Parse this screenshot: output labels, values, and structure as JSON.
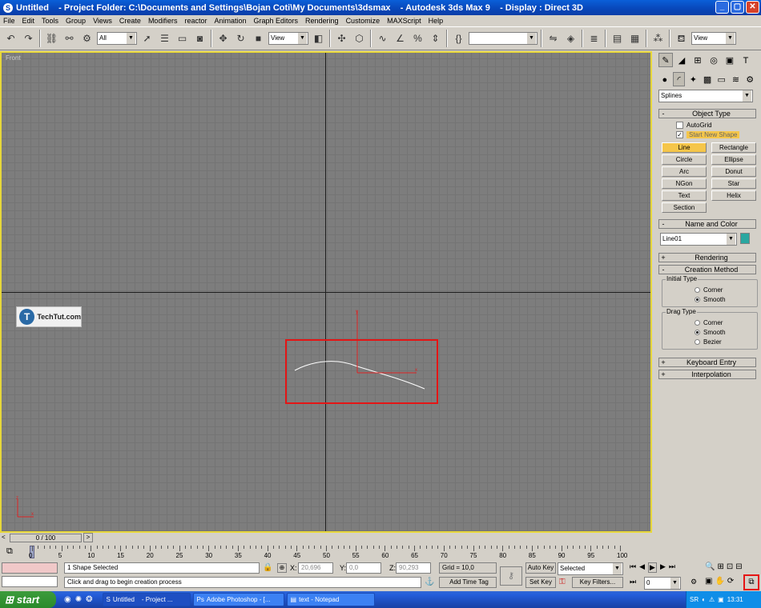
{
  "window": {
    "title": "Untitled    - Project Folder: C:\\Documents and Settings\\Bojan Coti\\My Documents\\3dsmax    - Autodesk 3ds Max 9    - Display : Direct 3D",
    "controls": [
      "_",
      "▢",
      "✕"
    ]
  },
  "menu": [
    "File",
    "Edit",
    "Tools",
    "Group",
    "Views",
    "Create",
    "Modifiers",
    "reactor",
    "Animation",
    "Graph Editors",
    "Rendering",
    "Customize",
    "MAXScript",
    "Help"
  ],
  "toolbar": {
    "selection_filter": "All",
    "ref_coord": "View",
    "named_selection": "",
    "view_right": "View"
  },
  "viewport": {
    "label": "Front",
    "watermark": "TechTut.com",
    "watermark_logo": "T"
  },
  "command_panel": {
    "category": "Splines",
    "object_type": {
      "header": "Object Type",
      "sign": "-",
      "autogrid": "AutoGrid",
      "start_new_shape": "Start New Shape",
      "buttons": [
        "Line",
        "Rectangle",
        "Circle",
        "Ellipse",
        "Arc",
        "Donut",
        "NGon",
        "Star",
        "Text",
        "Helix",
        "Section"
      ],
      "active": "Line"
    },
    "name_color": {
      "header": "Name and Color",
      "sign": "-",
      "name": "Line01",
      "color": "#2aa7a0"
    },
    "rendering": {
      "header": "Rendering",
      "sign": "+"
    },
    "creation_method": {
      "header": "Creation Method",
      "sign": "-",
      "initial_type": {
        "label": "Initial Type",
        "options": [
          "Corner",
          "Smooth"
        ],
        "selected": "Smooth"
      },
      "drag_type": {
        "label": "Drag Type",
        "options": [
          "Corner",
          "Smooth",
          "Bezier"
        ],
        "selected": "Smooth"
      }
    },
    "keyboard_entry": {
      "header": "Keyboard Entry",
      "sign": "+"
    },
    "interpolation": {
      "header": "Interpolation",
      "sign": "+"
    }
  },
  "timeline": {
    "slider": "0 / 100",
    "ticks": [
      "0",
      "5",
      "10",
      "15",
      "20",
      "25",
      "30",
      "35",
      "40",
      "45",
      "50",
      "55",
      "60",
      "65",
      "70",
      "75",
      "80",
      "85",
      "90",
      "95",
      "100"
    ]
  },
  "status": {
    "selection": "1 Shape Selected",
    "prompt": "Click and drag to begin creation process",
    "x_label": "X:",
    "x": "20,696",
    "y_label": "Y:",
    "y": "0,0",
    "z_label": "Z:",
    "z": "90,293",
    "grid": "Grid = 10,0",
    "add_time_tag": "Add Time Tag",
    "auto_key": "Auto Key",
    "set_key": "Set Key",
    "key_mode": "Selected",
    "key_filters": "Key Filters...",
    "frame": "0"
  },
  "taskbar": {
    "start": "start",
    "tasks": [
      "Untitled    - Project ...",
      "Adobe Photoshop - [...",
      "text - Notepad"
    ],
    "lang": "SR",
    "clock": "13:31"
  }
}
